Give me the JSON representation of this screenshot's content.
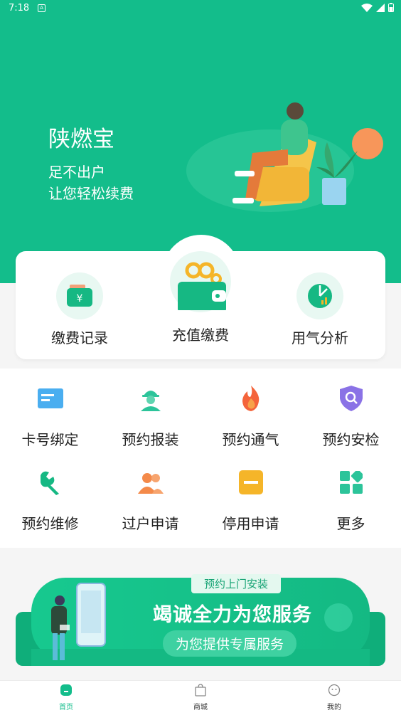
{
  "status_bar": {
    "time": "7:18",
    "notification_glyph": "A"
  },
  "hero": {
    "title": "陕燃宝",
    "subtitle_line1": "足不出户",
    "subtitle_line2": "让您轻松续费"
  },
  "quick_actions": [
    {
      "label": "缴费记录",
      "icon": "wallet-yen-icon"
    },
    {
      "label": "充值缴费",
      "icon": "wallet-coins-icon"
    },
    {
      "label": "用气分析",
      "icon": "pie-chart-icon"
    }
  ],
  "services": [
    {
      "label": "卡号绑定",
      "icon": "card-icon"
    },
    {
      "label": "预约报装",
      "icon": "worker-icon"
    },
    {
      "label": "预约通气",
      "icon": "flame-icon"
    },
    {
      "label": "预约安检",
      "icon": "shield-search-icon"
    },
    {
      "label": "预约维修",
      "icon": "wrench-icon"
    },
    {
      "label": "过户申请",
      "icon": "transfer-users-icon"
    },
    {
      "label": "停用申请",
      "icon": "stop-minus-icon"
    },
    {
      "label": "更多",
      "icon": "grid-more-icon"
    }
  ],
  "banner": {
    "tag": "预约上门安装",
    "headline": "竭诚全力为您服务",
    "subline": "为您提供专属服务"
  },
  "tabbar": {
    "items": [
      {
        "label": "首页",
        "icon": "home-icon",
        "active": true
      },
      {
        "label": "商城",
        "icon": "shopping-bag-icon",
        "active": false
      },
      {
        "label": "我的",
        "icon": "profile-icon",
        "active": false
      }
    ]
  },
  "colors": {
    "brand": "#13bd8b",
    "orange": "#f48a4a",
    "purple": "#8a72e6",
    "blue": "#4aaef0"
  }
}
